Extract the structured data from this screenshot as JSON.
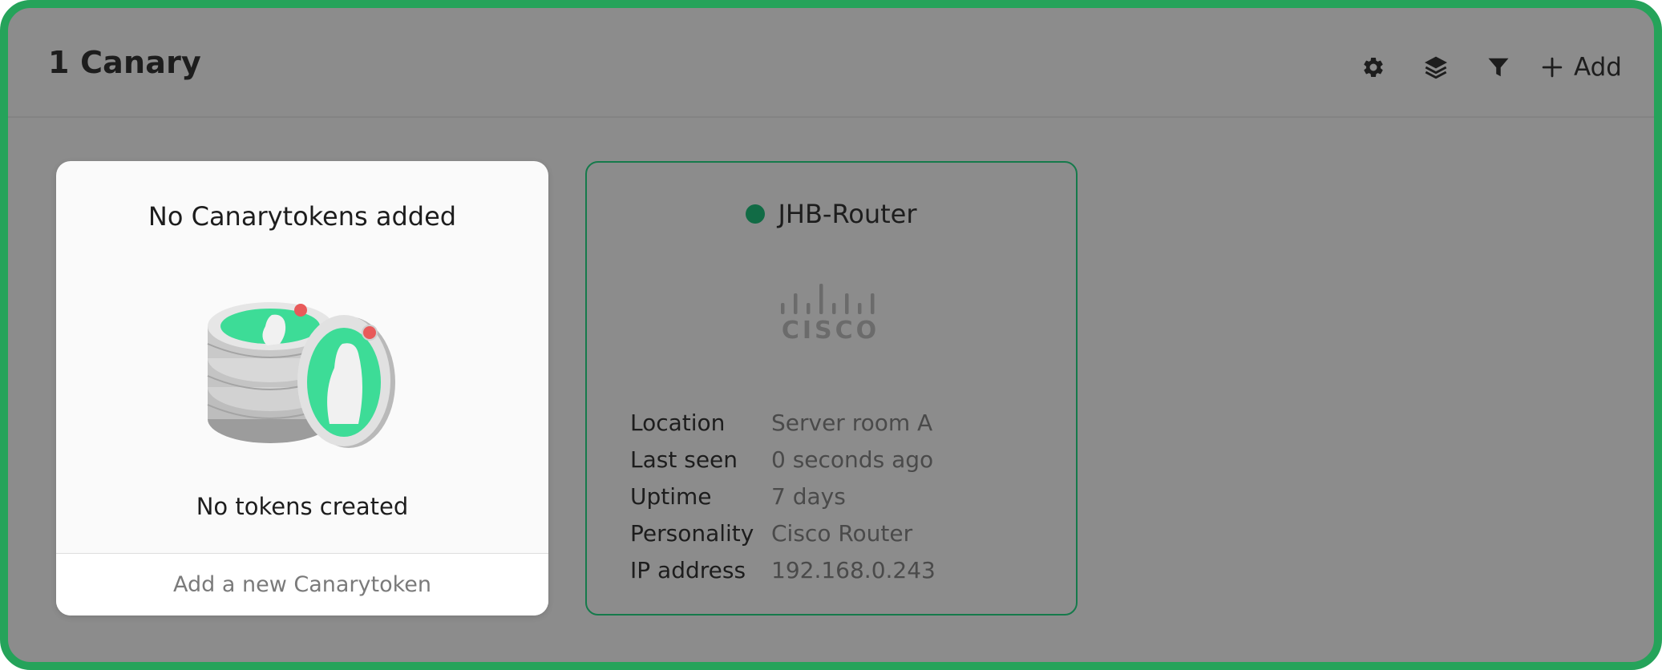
{
  "header": {
    "title": "1 Canary",
    "add_label": "Add"
  },
  "icons": {
    "settings": "gear-icon",
    "groups": "layers-icon",
    "filter": "filter-icon",
    "add": "plus-icon"
  },
  "tokens_card": {
    "title": "No Canarytokens added",
    "subtitle": "No tokens created",
    "footer_link": "Add a new Canarytoken"
  },
  "device_card": {
    "name": "JHB-Router",
    "status_color": "#116b45",
    "logo_text": "CISCO",
    "details": [
      {
        "key": "Location",
        "value": "Server room A"
      },
      {
        "key": "Last seen",
        "value": "0 seconds ago"
      },
      {
        "key": "Uptime",
        "value": "7 days"
      },
      {
        "key": "Personality",
        "value": "Cisco Router"
      },
      {
        "key": "IP address",
        "value": "192.168.0.243"
      }
    ]
  },
  "colors": {
    "frame_border": "#25a35a",
    "background": "#8c8c8c",
    "accent_green": "#3ddc97",
    "device_border": "#157a4b"
  }
}
